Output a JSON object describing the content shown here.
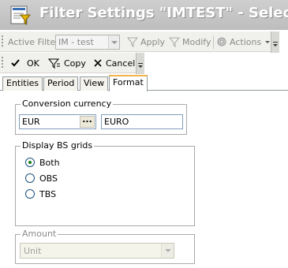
{
  "window": {
    "title": "Filter Settings \"IMTEST\" - Select",
    "app_icon": "filter-settings-app-icon"
  },
  "toolbar1": {
    "active_filter_label": "Active Filter",
    "active_filter_value": "IM - test",
    "apply_label": "Apply",
    "modify_label": "Modify",
    "actions_label": "Actions",
    "apply_icon": "filter-apply-icon",
    "modify_icon": "filter-modify-icon",
    "actions_icon": "gear-icon"
  },
  "toolbar2": {
    "ok_label": "OK",
    "copy_label": "Copy",
    "cancel_label": "Cancel",
    "ok_icon": "checkmark-icon",
    "copy_icon": "filter-copy-icon",
    "cancel_icon": "close-icon"
  },
  "tabs": [
    {
      "label": "Entities",
      "active": false
    },
    {
      "label": "Period",
      "active": false
    },
    {
      "label": "View",
      "active": false
    },
    {
      "label": "Format",
      "active": true
    }
  ],
  "conversion_currency": {
    "legend": "Conversion currency",
    "code": "EUR",
    "ellipsis": "...",
    "name": "EURO"
  },
  "display_bs_grids": {
    "legend": "Display BS grids",
    "options": [
      {
        "label": "Both",
        "selected": true
      },
      {
        "label": "OBS",
        "selected": false
      },
      {
        "label": "TBS",
        "selected": false
      }
    ]
  },
  "amount": {
    "legend": "Amount",
    "value": "Unit",
    "enabled": false
  },
  "colors": {
    "titlebar": "#c4c4c4",
    "toolbar": "#f0f0ed",
    "active_tab_accent": "#f3b34b",
    "field_border": "#7f9db9"
  }
}
